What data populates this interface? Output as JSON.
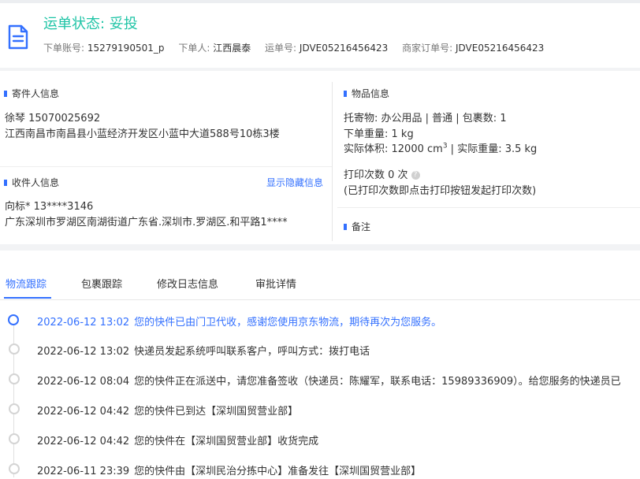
{
  "header": {
    "status": "运单状态: 妥投",
    "meta": [
      {
        "label": "下单账号:",
        "value": "15279190501_p"
      },
      {
        "label": "下单人:",
        "value": "江西晨泰"
      },
      {
        "label": "运单号:",
        "value": "JDVE05216456423"
      },
      {
        "label": "商家订单号:",
        "value": "JDVE05216456423"
      }
    ]
  },
  "sender": {
    "title": "寄件人信息",
    "name_phone": "徐琴   15070025692",
    "address": "江西南昌市南昌县小蓝经济开发区小蓝中大道588号10栋3楼"
  },
  "receiver": {
    "title": "收件人信息",
    "show_hidden": "显示隐藏信息",
    "name_phone": "向标*   13****3146",
    "address": "广东深圳市罗湖区南湖街道广东省.深圳市.罗湖区.和平路1****"
  },
  "goods": {
    "title": "物品信息",
    "line1": "托寄物:  办公用品 | 普通  |  包裹数:  1",
    "weight": "下单重量:  1 kg",
    "volume_label": "实际体积:   12000 cm",
    "volume_sup": "3",
    "actual_weight": " |  实际重量:   3.5 kg",
    "print_count": "打印次数   0 次",
    "print_note": "(已打印次数即点击打印按钮发起打印次数)"
  },
  "remark": {
    "title": "备注"
  },
  "tabs": [
    "物流跟踪",
    "包裹跟踪",
    "修改日志信息",
    "审批详情"
  ],
  "events": [
    {
      "time": "2022-06-12 13:02",
      "text": "您的快件已由门卫代收，感谢您使用京东物流，期待再次为您服务。"
    },
    {
      "time": "2022-06-12 13:02",
      "text": "快递员发起系统呼叫联系客户，呼叫方式：拨打电话"
    },
    {
      "time": "2022-06-12 08:04",
      "text": "您的快件正在派送中，请您准备签收（快递员：陈耀军，联系电话：15989336909）。给您服务的快递员已"
    },
    {
      "time": "2022-06-12 04:42",
      "text": "您的快件已到达【深圳国贸营业部】"
    },
    {
      "time": "2022-06-12 04:42",
      "text": "您的快件在【深圳国贸营业部】收货完成"
    },
    {
      "time": "2022-06-11 23:39",
      "text": "您的快件由【深圳民治分拣中心】准备发往【深圳国贸营业部】"
    }
  ],
  "colors": {
    "accent": "#3370ff",
    "status": "#1fc4a6"
  }
}
